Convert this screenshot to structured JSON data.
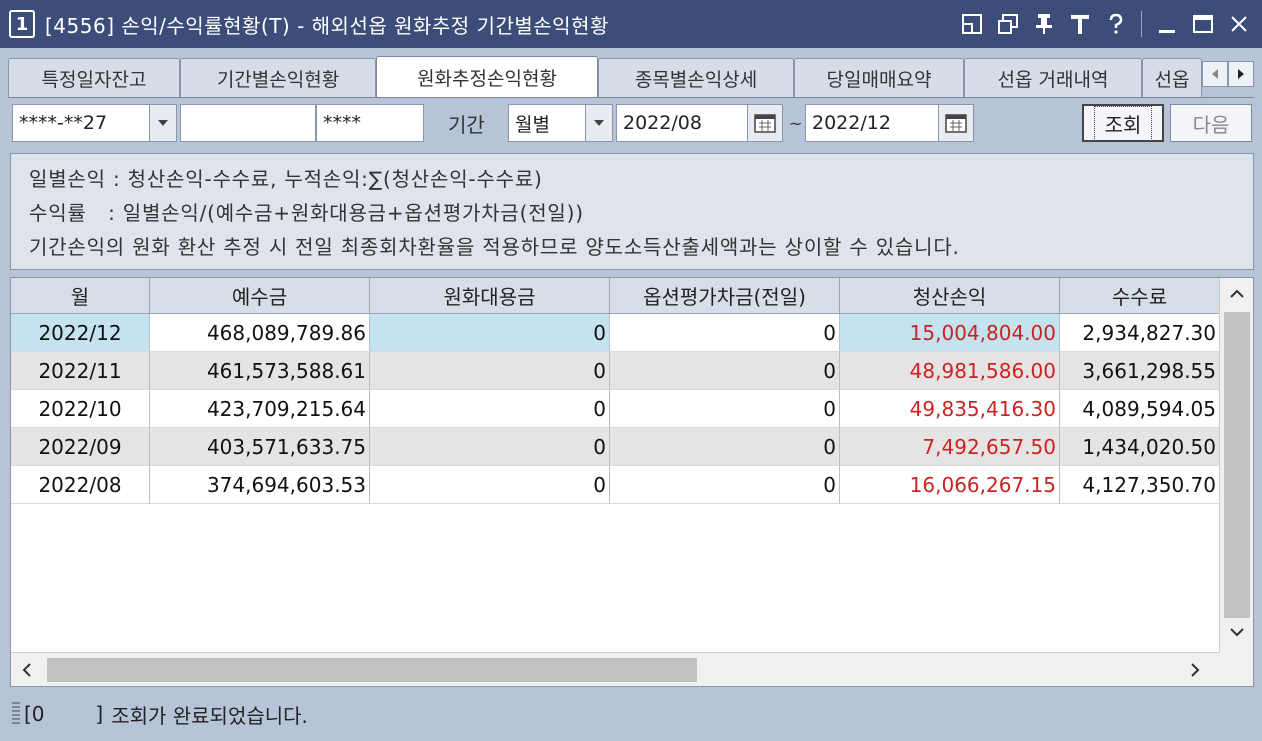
{
  "window": {
    "number": "1",
    "title": "[4556] 손익/수익률현황(T) - 해외선옵 원화추정 기간별손익현황"
  },
  "tabs": [
    {
      "label": "특정일자잔고"
    },
    {
      "label": "기간별손익현황"
    },
    {
      "label": "원화추정손익현황"
    },
    {
      "label": "종목별손익상세"
    },
    {
      "label": "당일매매요약"
    },
    {
      "label": "선옵 거래내역"
    },
    {
      "label": "선옵"
    }
  ],
  "toolbar": {
    "account": "****-**27",
    "account_name": "",
    "password": "****",
    "period_label": "기간",
    "period_value": "월별",
    "start_date": "2022/08",
    "tilde": "~",
    "end_date": "2022/12",
    "query_button": "조회",
    "next_button": "다음"
  },
  "info": {
    "line1": "일별손익 : 청산손익-수수료, 누적손익:∑(청산손익-수수료)",
    "line2": "수익률   : 일별손익/(예수금+원화대용금+옵션평가차금(전일))",
    "line3": "기간손익의 원화 환산 추정 시 전일 최종회차환율을 적용하므로 양도소득산출세액과는 상이할 수 있습니다."
  },
  "grid": {
    "columns": [
      "월",
      "예수금",
      "원화대용금",
      "옵션평가차금(전일)",
      "청산손익",
      "수수료"
    ],
    "rows": [
      [
        "2022/12",
        "468,089,789.86",
        "0",
        "0",
        "15,004,804.00",
        "2,934,827.30"
      ],
      [
        "2022/11",
        "461,573,588.61",
        "0",
        "0",
        "48,981,586.00",
        "3,661,298.55"
      ],
      [
        "2022/10",
        "423,709,215.64",
        "0",
        "0",
        "49,835,416.30",
        "4,089,594.05"
      ],
      [
        "2022/09",
        "403,571,633.75",
        "0",
        "0",
        "7,492,657.50",
        "1,434,020.50"
      ],
      [
        "2022/08",
        "374,694,603.53",
        "0",
        "0",
        "16,066,267.15",
        "4,127,350.70"
      ]
    ]
  },
  "status": {
    "code": "[0        ]",
    "message": "조회가 완료되었습니다."
  },
  "colors": {
    "titlebar": "#3b4d78",
    "selected_row": "#c5e3ef",
    "alt_row": "#e4e4e4",
    "profit_text": "#cc2222"
  }
}
